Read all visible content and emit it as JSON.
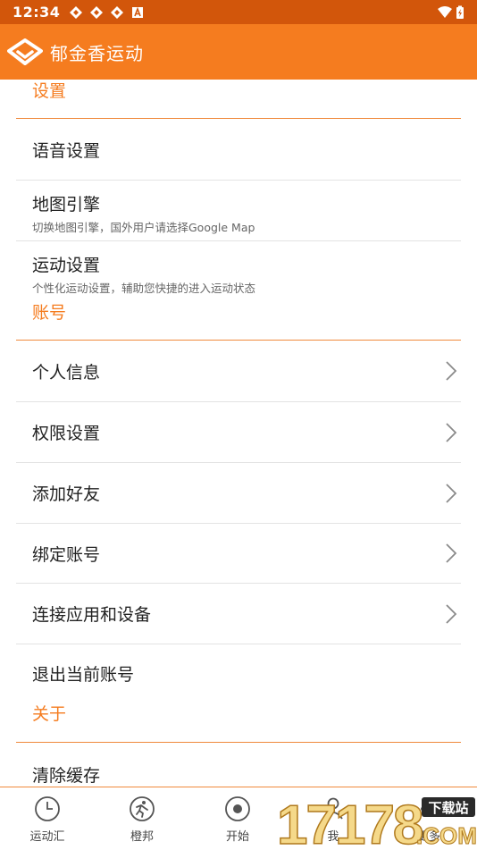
{
  "status": {
    "time": "12:34"
  },
  "app": {
    "title": "郁金香运动"
  },
  "sections": {
    "settings": "设置",
    "account": "账号",
    "about": "关于"
  },
  "items": {
    "voice": {
      "label": "语音设置"
    },
    "map": {
      "label": "地图引擎",
      "sub": "切换地图引擎，国外用户请选择Google Map"
    },
    "sport": {
      "label": "运动设置",
      "sub": "个性化运动设置，辅助您快捷的进入运动状态"
    },
    "personal": {
      "label": "个人信息"
    },
    "permissions": {
      "label": "权限设置"
    },
    "add_friend": {
      "label": "添加好友"
    },
    "bind": {
      "label": "绑定账号"
    },
    "connect": {
      "label": "连接应用和设备"
    },
    "logout": {
      "label": "退出当前账号"
    },
    "clear_cache": {
      "label": "清除缓存"
    }
  },
  "tabs": [
    "运动汇",
    "橙邦",
    "开始",
    "我",
    "更多"
  ],
  "watermark": {
    "number": "17178",
    "tag": "下载站",
    "domain": ".COM"
  },
  "colors": {
    "statusbar": "#d2560b",
    "appbar": "#f57c1f",
    "accent": "#f57c1f"
  }
}
